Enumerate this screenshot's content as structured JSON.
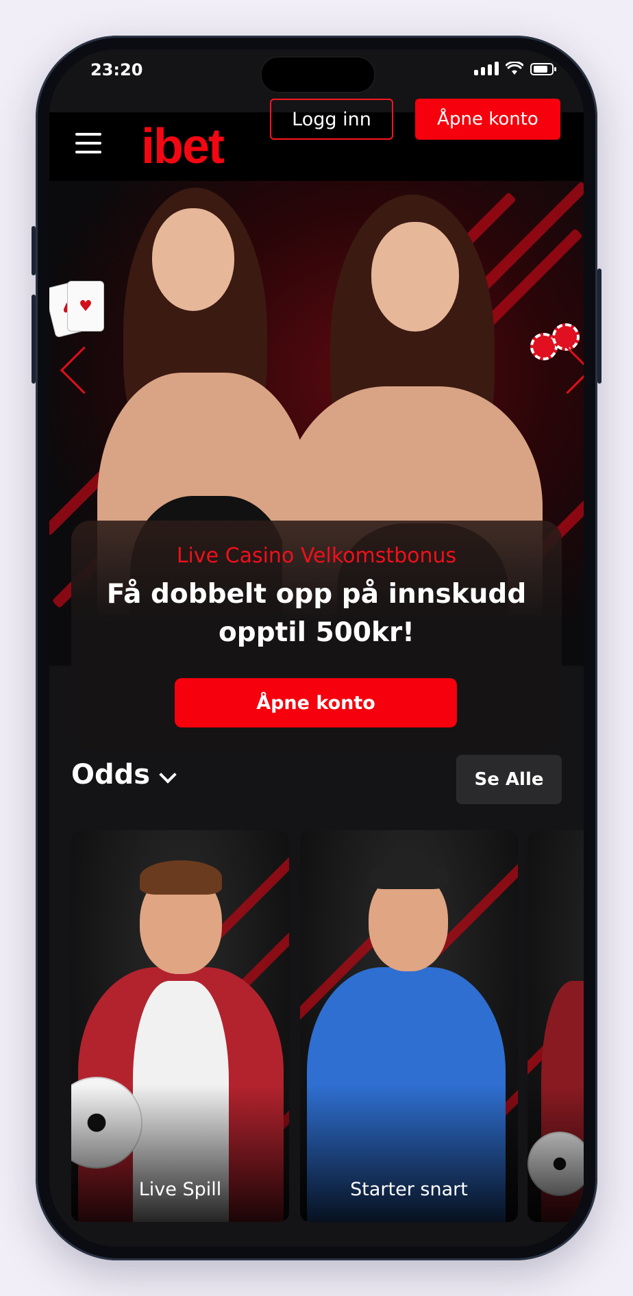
{
  "status_bar": {
    "time": "23:20"
  },
  "header": {
    "logo": "ibet",
    "login_label": "Logg inn",
    "open_account_label": "Åpne konto"
  },
  "promo": {
    "subtitle": "Live Casino Velkomstbonus",
    "title": "Få dobbelt opp på innskudd opptil 500kr!",
    "cta": "Åpne konto"
  },
  "odds": {
    "title": "Odds",
    "see_all": "Se Alle",
    "cards": [
      {
        "label": "Live Spill"
      },
      {
        "label": "Starter snart"
      },
      {
        "label": ""
      }
    ]
  },
  "colors": {
    "brand_red": "#f5000c",
    "background": "#141416"
  }
}
